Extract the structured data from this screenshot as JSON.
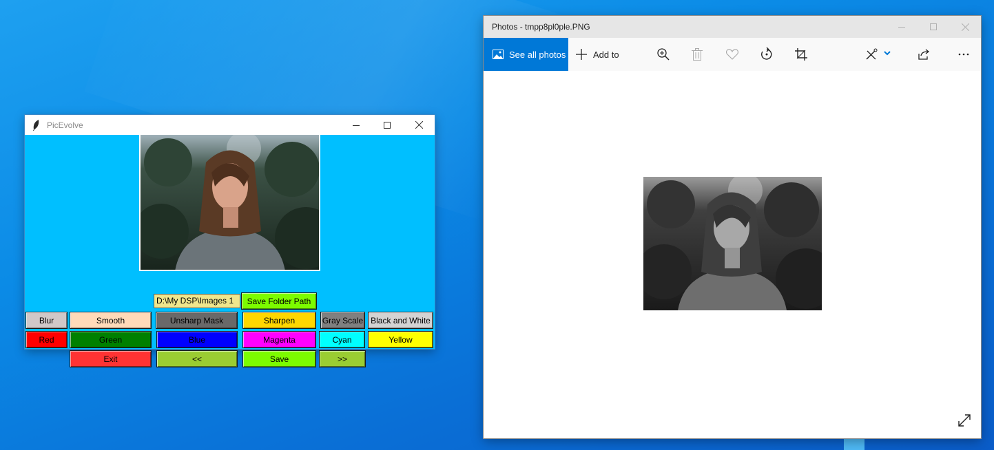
{
  "desktop": {
    "background": "#0a82e0"
  },
  "picevolve": {
    "title": "PicEvolve",
    "path_entry_value": "D:\\My DSP\\Images 1",
    "buttons": {
      "save_folder_path": {
        "label": "Save Folder Path",
        "color": "#7cfc00"
      },
      "blur": {
        "label": "Blur",
        "color": "#d0c8c8"
      },
      "smooth": {
        "label": "Smooth",
        "color": "#ffdab9"
      },
      "unsharp_mask": {
        "label": "Unsharp Mask",
        "color": "#696969"
      },
      "sharpen": {
        "label": "Sharpen",
        "color": "#ffd700"
      },
      "gray_scale": {
        "label": "Gray Scale",
        "color": "#808080"
      },
      "black_and_white": {
        "label": "Black and White",
        "color": "#d3d3d3"
      },
      "red": {
        "label": "Red",
        "color": "#ff0000"
      },
      "green": {
        "label": "Green",
        "color": "#008000"
      },
      "blue": {
        "label": "Blue",
        "color": "#0000ff"
      },
      "magenta": {
        "label": "Magenta",
        "color": "#ff00ff"
      },
      "cyan": {
        "label": "Cyan",
        "color": "#00ffff"
      },
      "yellow": {
        "label": "Yellow",
        "color": "#ffff00"
      },
      "exit": {
        "label": "Exit",
        "color": "#ff3333"
      },
      "prev": {
        "label": "<<",
        "color": "#9acd32"
      },
      "save": {
        "label": "Save",
        "color": "#7cfc00"
      },
      "next": {
        "label": ">>",
        "color": "#9acd32"
      }
    }
  },
  "photos": {
    "title": "Photos - tmpp8pl0ple.PNG",
    "toolbar": {
      "see_all_photos": "See all photos",
      "add_to": "Add to",
      "icons": [
        "zoom-in-icon",
        "delete-icon",
        "favorite-icon",
        "rotate-icon",
        "crop-icon",
        "edit-icon",
        "share-icon",
        "more-icon"
      ]
    },
    "accent": "#0078d7"
  }
}
